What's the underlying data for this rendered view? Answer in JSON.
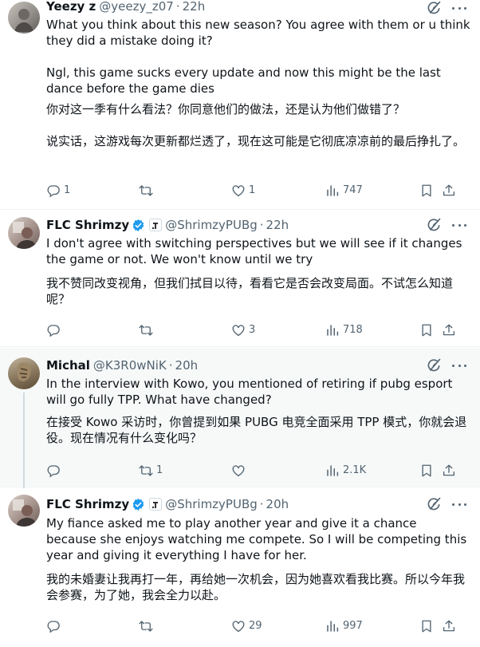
{
  "tweets": [
    {
      "name": "Yeezy z",
      "handle": "@yeezy_z07",
      "time": "22h",
      "verified": false,
      "text_en": "What you think about this new season? You agree with them or u think they did a mistake doing it?\n\nNgl, this game sucks every update and now this might be the last dance before the game dies",
      "text_zh": "你对这一季有什么看法？你同意他们的做法，还是认为他们做错了？\n\n说实话，这游戏每次更新都烂透了，现在这可能是它彻底凉凉前的最后挣扎了。",
      "replies": "1",
      "retweets": "",
      "likes": "1",
      "views": "747"
    },
    {
      "name": "FLC Shrimzy",
      "handle": "@ShrimzyPUBg",
      "time": "22h",
      "verified": true,
      "text_en": "I don't agree with switching perspectives but we will see if it changes the game or not. We won't know until we try",
      "text_zh": "我不赞同改变视角，但我们拭目以待，看看它是否会改变局面。不试怎么知道呢？",
      "replies": "",
      "retweets": "",
      "likes": "3",
      "views": "718"
    },
    {
      "name": "Michal",
      "handle": "@K3R0wNiK",
      "time": "20h",
      "verified": false,
      "text_en": "In the interview with Kowo, you mentioned of retiring if pubg esport will go fully TPP. What have changed?",
      "text_zh": "在接受 Kowo 采访时，你曾提到如果 PUBG 电竞全面采用 TPP 模式，你就会退役。现在情况有什么变化吗？",
      "replies": "",
      "retweets": "1",
      "likes": "",
      "views": "2.1K"
    },
    {
      "name": "FLC Shrimzy",
      "handle": "@ShrimzyPUBg",
      "time": "20h",
      "verified": true,
      "text_en": "My fiance asked me to play another year and give it a chance because she enjoys watching me compete. So I will be competing this year and giving it everything I have for her.",
      "text_zh": "我的未婚妻让我再打一年，再给她一次机会，因为她喜欢看我比赛。所以今年我会参赛，为了她，我会全力以赴。",
      "replies": "",
      "retweets": "",
      "likes": "29",
      "views": "997"
    }
  ],
  "separator": "·",
  "colors": {
    "text": "#0f1419",
    "muted": "#536471",
    "verified_blue": "#1d9bf0",
    "highlight_bg": "#f7f9f9",
    "border": "#eff3f4"
  },
  "icons": [
    "reply-icon",
    "retweet-icon",
    "like-icon",
    "views-icon",
    "bookmark-icon",
    "share-icon",
    "grok-icon",
    "more-icon",
    "verified-badge-icon",
    "affiliate-badge-icon"
  ]
}
